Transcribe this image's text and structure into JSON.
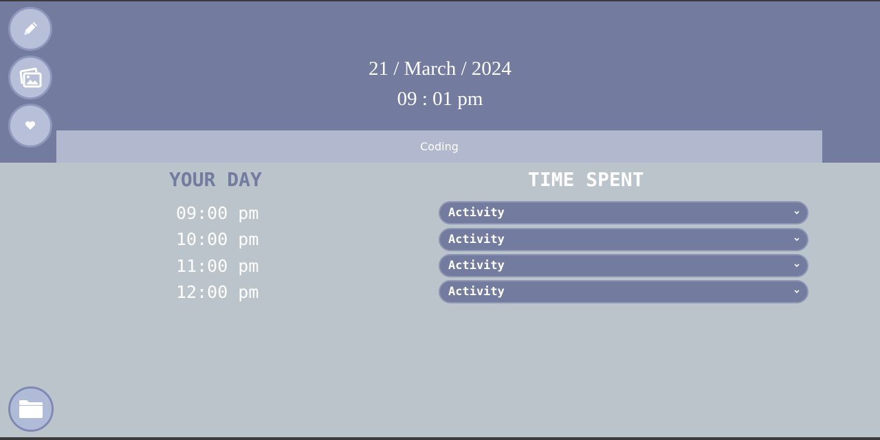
{
  "header": {
    "date": "21 / March / 2024",
    "time": "09 : 01 pm",
    "banner": "Coding"
  },
  "sidebar": {
    "buttons": [
      {
        "icon": "pencil-icon"
      },
      {
        "icon": "gallery-icon"
      },
      {
        "icon": "heart-icon"
      }
    ],
    "folder_icon": "folder-icon"
  },
  "main": {
    "left_title": "YOUR DAY",
    "right_title": "TIME SPENT",
    "rows": [
      {
        "hour": "09:00 pm",
        "activity": "Activity"
      },
      {
        "hour": "10:00 pm",
        "activity": "Activity"
      },
      {
        "hour": "11:00 pm",
        "activity": "Activity"
      },
      {
        "hour": "12:00 pm",
        "activity": "Activity"
      }
    ]
  },
  "colors": {
    "header_bg": "#737b9f",
    "banner_bg": "#b2b8cd",
    "page_bg": "#bcc4cb",
    "accent": "#737b9f"
  }
}
